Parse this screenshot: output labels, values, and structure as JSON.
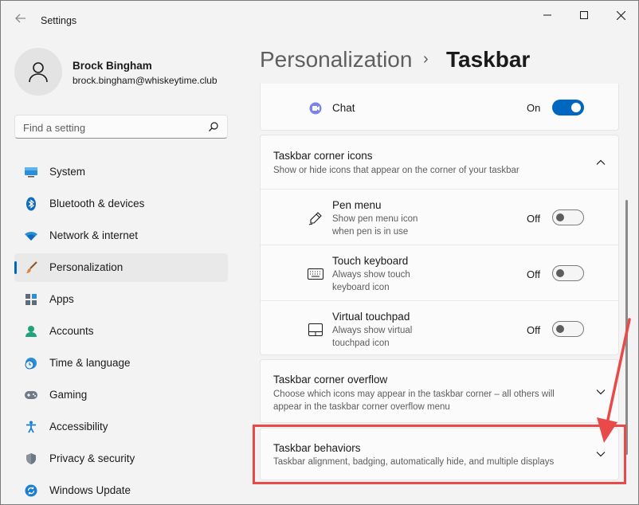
{
  "window": {
    "title": "Settings"
  },
  "profile": {
    "name": "Brock Bingham",
    "email": "brock.bingham@whiskeytime.club"
  },
  "search": {
    "placeholder": "Find a setting"
  },
  "nav": [
    {
      "label": "System",
      "icon": "monitor-icon"
    },
    {
      "label": "Bluetooth & devices",
      "icon": "bluetooth-icon"
    },
    {
      "label": "Network & internet",
      "icon": "wifi-icon"
    },
    {
      "label": "Personalization",
      "icon": "brush-icon",
      "selected": true
    },
    {
      "label": "Apps",
      "icon": "apps-icon"
    },
    {
      "label": "Accounts",
      "icon": "person-icon"
    },
    {
      "label": "Time & language",
      "icon": "globe-clock-icon"
    },
    {
      "label": "Gaming",
      "icon": "gamepad-icon"
    },
    {
      "label": "Accessibility",
      "icon": "accessibility-icon"
    },
    {
      "label": "Privacy & security",
      "icon": "shield-icon"
    },
    {
      "label": "Windows Update",
      "icon": "update-icon"
    }
  ],
  "breadcrumb": {
    "parent": "Personalization",
    "separator": "›",
    "current": "Taskbar"
  },
  "chat": {
    "label": "Chat",
    "state": "On"
  },
  "corner_icons": {
    "title": "Taskbar corner icons",
    "desc": "Show or hide icons that appear on the corner of your taskbar",
    "items": [
      {
        "title": "Pen menu",
        "desc1": "Show pen menu icon",
        "desc2": "when pen is in use",
        "state": "Off"
      },
      {
        "title": "Touch keyboard",
        "desc1": "Always show touch",
        "desc2": "keyboard icon",
        "state": "Off"
      },
      {
        "title": "Virtual touchpad",
        "desc1": "Always show virtual",
        "desc2": "touchpad icon",
        "state": "Off"
      }
    ]
  },
  "overflow": {
    "title": "Taskbar corner overflow",
    "desc1": "Choose which icons may appear in the taskbar corner – all others will",
    "desc2": "appear in the taskbar corner overflow menu"
  },
  "behaviors": {
    "title": "Taskbar behaviors",
    "desc": "Taskbar alignment, badging, automatically hide, and multiple displays"
  },
  "colors": {
    "accent": "#0067c0",
    "annotation": "#e84a4a"
  }
}
